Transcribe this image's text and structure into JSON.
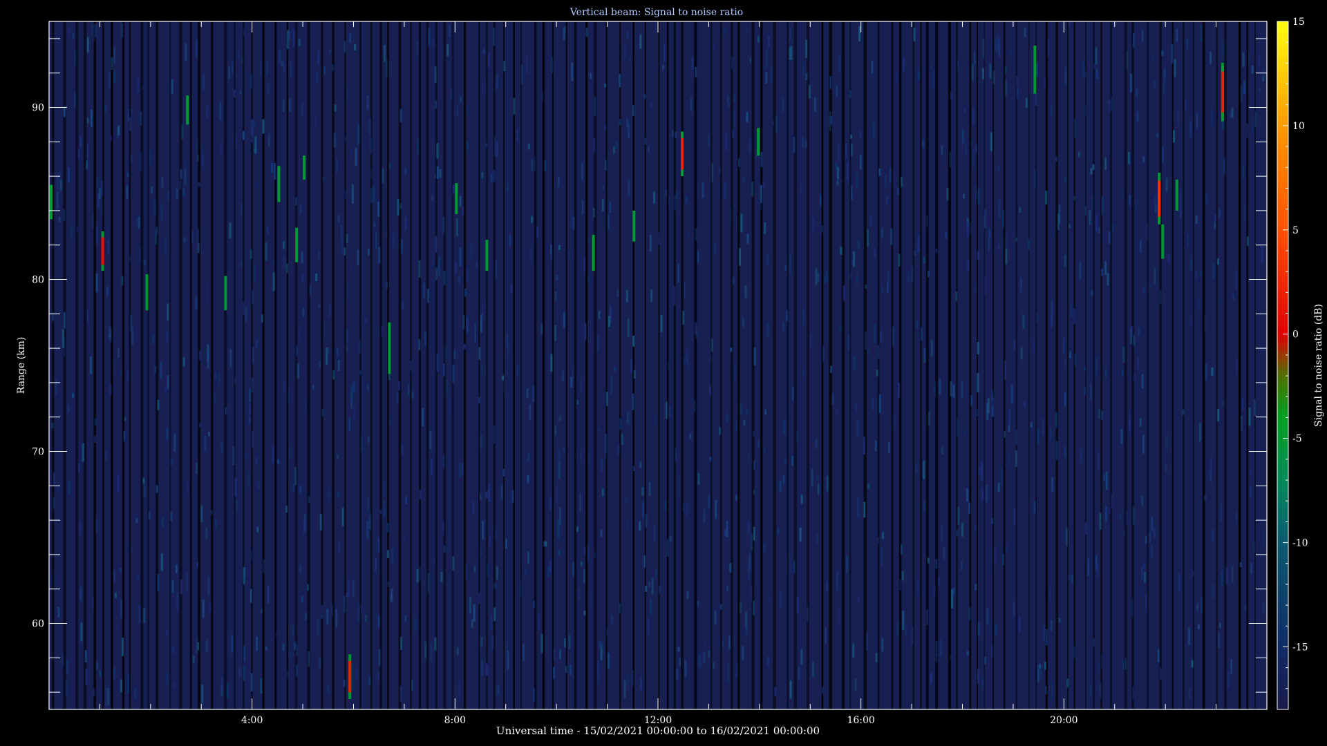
{
  "chart_data": {
    "type": "heatmap",
    "title": "Vertical beam: Signal to noise ratio",
    "xlabel": "Universal time - 15/02/2021 00:00:00 to 16/02/2021 00:00:00",
    "ylabel": "Range (km)",
    "colorbar_label": "Signal to noise ratio (dB)",
    "x_unit": "hours UT",
    "xlim": [
      0,
      24
    ],
    "ylim": [
      55,
      95
    ],
    "x_ticks": [
      {
        "value": 4,
        "label": "4:00"
      },
      {
        "value": 8,
        "label": "8:00"
      },
      {
        "value": 12,
        "label": "12:00"
      },
      {
        "value": 16,
        "label": "16:00"
      },
      {
        "value": 20,
        "label": "20:00"
      }
    ],
    "y_ticks": [
      {
        "value": 60,
        "label": "60"
      },
      {
        "value": 70,
        "label": "70"
      },
      {
        "value": 80,
        "label": "80"
      },
      {
        "value": 90,
        "label": "90"
      }
    ],
    "colorbar_range": [
      -18,
      15
    ],
    "colorbar_ticks": [
      {
        "value": 15,
        "label": "15"
      },
      {
        "value": 10,
        "label": "10"
      },
      {
        "value": 5,
        "label": "5"
      },
      {
        "value": 0,
        "label": "0"
      },
      {
        "value": -5,
        "label": "-5"
      },
      {
        "value": -10,
        "label": "-10"
      },
      {
        "value": -15,
        "label": "-15"
      }
    ],
    "colormap": [
      {
        "value": -18,
        "color": "#1a1a4a"
      },
      {
        "value": -15,
        "color": "#102a66"
      },
      {
        "value": -10,
        "color": "#0a5a70"
      },
      {
        "value": -7,
        "color": "#008a5a"
      },
      {
        "value": -4,
        "color": "#00a020"
      },
      {
        "value": -2,
        "color": "#507000"
      },
      {
        "value": 0,
        "color": "#e00000"
      },
      {
        "value": 5,
        "color": "#ff5000"
      },
      {
        "value": 10,
        "color": "#ff9a00"
      },
      {
        "value": 15,
        "color": "#ffff10"
      }
    ],
    "background_snr_db": -17,
    "detections": [
      {
        "time_h": 0.0,
        "range_min_km": 83.5,
        "range_max_km": 85.5,
        "peak_snr_db": -5
      },
      {
        "time_h": 1.03,
        "range_min_km": 80.5,
        "range_max_km": 82.8,
        "peak_snr_db": 1
      },
      {
        "time_h": 1.9,
        "range_min_km": 78.2,
        "range_max_km": 80.3,
        "peak_snr_db": -5
      },
      {
        "time_h": 2.7,
        "range_min_km": 89.0,
        "range_max_km": 90.7,
        "peak_snr_db": -7
      },
      {
        "time_h": 3.45,
        "range_min_km": 78.2,
        "range_max_km": 80.2,
        "peak_snr_db": -6
      },
      {
        "time_h": 4.5,
        "range_min_km": 84.5,
        "range_max_km": 86.6,
        "peak_snr_db": -7
      },
      {
        "time_h": 4.85,
        "range_min_km": 81.0,
        "range_max_km": 83.0,
        "peak_snr_db": -8
      },
      {
        "time_h": 5.0,
        "range_min_km": 85.8,
        "range_max_km": 87.2,
        "peak_snr_db": -7
      },
      {
        "time_h": 5.9,
        "range_min_km": 55.6,
        "range_max_km": 58.2,
        "peak_snr_db": 2
      },
      {
        "time_h": 6.68,
        "range_min_km": 74.5,
        "range_max_km": 77.5,
        "peak_snr_db": -7
      },
      {
        "time_h": 8.0,
        "range_min_km": 83.8,
        "range_max_km": 85.6,
        "peak_snr_db": -5
      },
      {
        "time_h": 8.6,
        "range_min_km": 80.5,
        "range_max_km": 82.3,
        "peak_snr_db": -6
      },
      {
        "time_h": 10.7,
        "range_min_km": 80.5,
        "range_max_km": 82.6,
        "peak_snr_db": -5
      },
      {
        "time_h": 11.5,
        "range_min_km": 82.2,
        "range_max_km": 84.0,
        "peak_snr_db": -8
      },
      {
        "time_h": 12.45,
        "range_min_km": 86.0,
        "range_max_km": 88.6,
        "peak_snr_db": 2
      },
      {
        "time_h": 13.95,
        "range_min_km": 87.2,
        "range_max_km": 88.8,
        "peak_snr_db": -7
      },
      {
        "time_h": 19.4,
        "range_min_km": 90.8,
        "range_max_km": 93.6,
        "peak_snr_db": -5
      },
      {
        "time_h": 21.85,
        "range_min_km": 83.2,
        "range_max_km": 86.2,
        "peak_snr_db": 3
      },
      {
        "time_h": 21.92,
        "range_min_km": 81.2,
        "range_max_km": 83.2,
        "peak_snr_db": -4
      },
      {
        "time_h": 22.2,
        "range_min_km": 84.0,
        "range_max_km": 85.8,
        "peak_snr_db": -6
      },
      {
        "time_h": 23.1,
        "range_min_km": 89.2,
        "range_max_km": 92.6,
        "peak_snr_db": 2
      }
    ],
    "grid": false,
    "legend": "colorbar-right"
  }
}
